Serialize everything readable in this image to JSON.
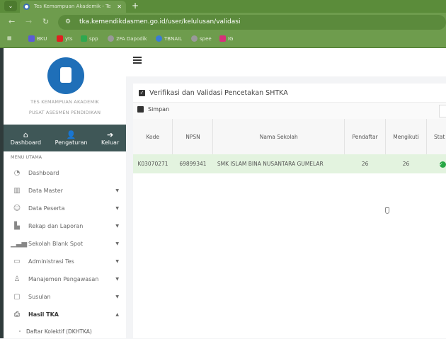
{
  "browser": {
    "tab_title": "Tes Kemampuan Akademik - Te",
    "url": "tka.kemendikdasmen.go.id/user/kelulusan/validasi",
    "bookmarks": [
      {
        "label": "BKU",
        "color": "#5b5bd6"
      },
      {
        "label": "yts",
        "color": "#e02020"
      },
      {
        "label": "spp",
        "color": "#2fa84f"
      },
      {
        "label": "2FA Dapodik",
        "color": "#999999"
      },
      {
        "label": "TBNAIL",
        "color": "#3a7bd5"
      },
      {
        "label": "spee",
        "color": "#999999"
      },
      {
        "label": "IG",
        "color": "#d6307a"
      }
    ]
  },
  "sidebar": {
    "org_line1": "TES KEMAMPUAN AKADEMIK",
    "org_line2": "PUSAT ASESMEN PENDIDIKAN",
    "quick": [
      {
        "label": "Dashboard",
        "icon": "home-icon"
      },
      {
        "label": "Pengaturan",
        "icon": "user-gear-icon"
      },
      {
        "label": "Keluar",
        "icon": "logout-icon"
      }
    ],
    "menu_header": "MENU UTAMA",
    "items": [
      {
        "label": "Dashboard",
        "icon": "dashboard-icon"
      },
      {
        "label": "Data Master",
        "icon": "building-icon"
      },
      {
        "label": "Data Peserta",
        "icon": "student-icon"
      },
      {
        "label": "Rekap dan Laporan",
        "icon": "chart-icon"
      },
      {
        "label": "Sekolah Blank Spot",
        "icon": "signal-icon"
      },
      {
        "label": "Administrasi Tes",
        "icon": "monitor-icon"
      },
      {
        "label": "Manajemen Pengawasan",
        "icon": "supervisor-icon"
      },
      {
        "label": "Susulan",
        "icon": "calendar-icon"
      },
      {
        "label": "Hasil TKA",
        "icon": "pdf-icon"
      }
    ],
    "subitems": [
      {
        "label": "Daftar Kolektif (DKHTKA)"
      }
    ]
  },
  "main": {
    "title": "Verifikasi dan Validasi Pencetakan SHTKA",
    "save_label": "Simpan",
    "columns": [
      "Kode",
      "NPSN",
      "Nama Sekolah",
      "Pendaftar",
      "Mengikuti",
      "Stat TK"
    ],
    "rows": [
      {
        "kode": "K03070271",
        "npsn": "69899341",
        "nama": "SMK ISLAM BINA NUSANTARA GUMELAR",
        "pendaftar": "26",
        "mengikuti": "26",
        "status": "check-icon"
      }
    ]
  },
  "colors": {
    "browser": "#6e9c4d",
    "sidebar_quick": "#3f5757",
    "row_highlight": "#e3f3df"
  }
}
